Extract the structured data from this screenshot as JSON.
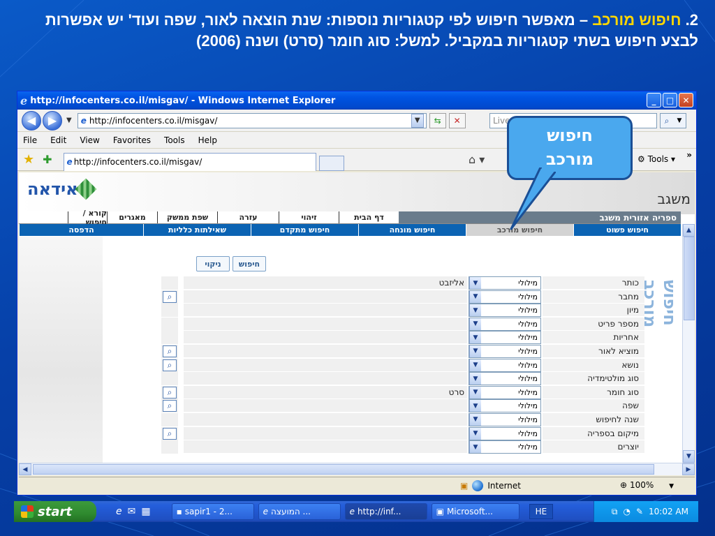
{
  "slide": {
    "heading_num": "2.",
    "heading_highlight": "חיפוש מורכב",
    "heading_rest": " – מאפשר חיפוש לפי קטגוריות נוספות: שנת הוצאה לאור, שפה ועוד' יש אפשרות לבצע חיפוש בשתי קטגוריות במקביל. למשל: סוג חומר (סרט) ושנה (2006)"
  },
  "browser": {
    "title": "http://infocenters.co.il/misgav/ - Windows Internet Explorer",
    "address": "http://infocenters.co.il/misgav/",
    "search_placeholder": "Live Search",
    "menu": [
      "File",
      "Edit",
      "View",
      "Favorites",
      "Tools",
      "Help"
    ],
    "tab_title": "http://infocenters.co.il/misgav/",
    "tools_label": "Tools",
    "status_zone": "Internet",
    "zoom": "100%"
  },
  "site": {
    "logo_text": "אידאה",
    "name": "משגב",
    "system_label": "ספריה אזורית משגב",
    "top_nav": [
      "דף הבית",
      "זיהוי",
      "עזרה",
      "שפת ממשק",
      "מאגרים",
      "קורא / חיפוש"
    ],
    "search_tabs": [
      "חיפוש פשוט",
      "חיפוש מורכב",
      "חיפוש מונחה",
      "חיפוש מתקדם",
      "שאילתות כלליות",
      "הדפסה"
    ],
    "active_tab_index": 1,
    "vertical_title": "חיפוש מורכב",
    "search_button": "חיפוש",
    "clear_button": "ניקוי"
  },
  "form": {
    "rows": [
      {
        "label": "כותר",
        "op": "מילולי",
        "value": "אליזבט",
        "lookup": false
      },
      {
        "label": "מחבר",
        "op": "מילולי",
        "value": "",
        "lookup": true
      },
      {
        "label": "מיון",
        "op": "מילולי",
        "value": "",
        "lookup": false
      },
      {
        "label": "מספר פריט",
        "op": "מילולי",
        "value": "",
        "lookup": false
      },
      {
        "label": "אחריות",
        "op": "מילולי",
        "value": "",
        "lookup": false
      },
      {
        "label": "מוציא לאור",
        "op": "מילולי",
        "value": "",
        "lookup": true
      },
      {
        "label": "נושא",
        "op": "מילולי",
        "value": "",
        "lookup": true
      },
      {
        "label": "סוג מולטימדיה",
        "op": "מילולי",
        "value": "",
        "lookup": false
      },
      {
        "label": "סוג חומר",
        "op": "מילולי",
        "value": "סרט",
        "lookup": true
      },
      {
        "label": "שפה",
        "op": "מילולי",
        "value": "",
        "lookup": true
      },
      {
        "label": "שנה לחיפוש",
        "op": "מילולי",
        "value": "",
        "lookup": false
      },
      {
        "label": "מיקום בספריה",
        "op": "מילולי",
        "value": "",
        "lookup": true
      },
      {
        "label": "יוצרים",
        "op": "מילולי",
        "value": "",
        "lookup": false
      }
    ]
  },
  "callout": {
    "line1": "חיפוש",
    "line2": "מורכב"
  },
  "taskbar": {
    "start": "start",
    "tasks": [
      "sapir1 - 2...",
      "המועצה ...",
      "http://inf...",
      "Microsoft..."
    ],
    "active_task_index": 2,
    "lang": "HE",
    "time": "10:02 AM"
  },
  "colors": {
    "slide_bg": "#0640a8",
    "highlight": "#ffd600",
    "site_tab_bar": "#0b63b3",
    "callout": "#4aa8ee"
  }
}
